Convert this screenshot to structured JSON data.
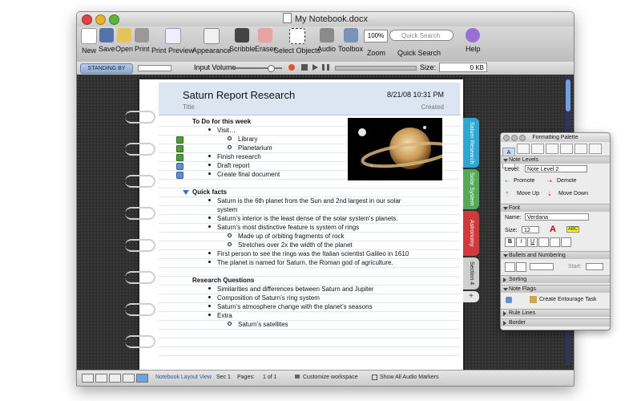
{
  "window": {
    "title": "My Notebook.docx"
  },
  "toolbar": {
    "new": "New",
    "save": "Save",
    "open": "Open",
    "print": "Print",
    "print_preview": "Print Preview",
    "appearance": "Appearance",
    "scribble": "Scribble",
    "eraser": "Eraser",
    "select_objects": "Select Objects",
    "audio": "Audio",
    "toolbox": "Toolbox",
    "zoom": "Zoom",
    "zoom_value": "100%",
    "search_placeholder": "Quick Search",
    "quick_search": "Quick Search",
    "help": "Help"
  },
  "recorder": {
    "status": "STANDING BY",
    "input_volume": "Input Volume",
    "size_label": "Size:",
    "size_value": "0 KB",
    "volume_level": 0.75
  },
  "note": {
    "title": "Saturn Report Research",
    "title_caption": "Title",
    "date": "8/21/08 10:31 PM",
    "created_caption": "Created"
  },
  "todo": {
    "heading": "To Do for this week",
    "visit": "Visit…",
    "library": "Library",
    "planetarium": "Planetarium",
    "finish": "Finish research",
    "draft": "Draft report",
    "create": "Create final document"
  },
  "facts": {
    "heading": "Quick facts",
    "f1a": "Saturn is the 6th planet from the Sun and 2nd largest in our solar",
    "f1b": "system",
    "f2": "Saturn’s interior is the least dense of the solar system’s planets.",
    "f3": "Saturn’s most distinctive feature is system of rings",
    "f3a": "Made up of orbiting fragments of rock",
    "f3b": "Stretches over 2x the width of the planet",
    "f4": "First person to see the rings was the Italian scientist Galileo in 1610",
    "f5": "The planet is named for Saturn, the Roman god of agriculture."
  },
  "questions": {
    "heading": "Research Questions",
    "q1": "Similarities and differences between Saturn and Jupiter",
    "q2": "Composition of Saturn’s ring system",
    "q3": "Saturn’s atmosphere change with the planet’s seasons",
    "q4": "Extra",
    "q4a": "Saturn’s satellites"
  },
  "tabs": [
    "Saturn Research",
    "Solar System",
    "Astronomy",
    "Section 4"
  ],
  "tab_colors": [
    "#2fa7d4",
    "#56a957",
    "#cf3a3a",
    "#cfcfcf"
  ],
  "statusbar": {
    "view": "Notebook Layout View",
    "sec": "Sec",
    "sec_num": "1",
    "pages": "Pages:",
    "pages_val": "1 of 1",
    "customize": "Customize workspace",
    "markers": "Show All Audio Markers"
  },
  "palette": {
    "title": "Formatting Palette",
    "note_levels": "Note Levels",
    "level_label": "Level:",
    "level_value": "Note Level 2",
    "promote": "Promote",
    "demote": "Demote",
    "move_up": "Move Up",
    "move_down": "Move Down",
    "font": "Font",
    "name_label": "Name:",
    "name_value": "Verdana",
    "size_label": "Size:",
    "size_value": "12",
    "bold": "B",
    "italic": "I",
    "underline": "U",
    "font_color": "A",
    "highlight": "ABC",
    "bullets": "Bullets and Numbering",
    "start_label": "Start:",
    "sorting": "Sorting",
    "note_flags": "Note Flags",
    "entourage": "Create Entourage Task",
    "rule_lines": "Rule Lines",
    "border": "Border"
  }
}
